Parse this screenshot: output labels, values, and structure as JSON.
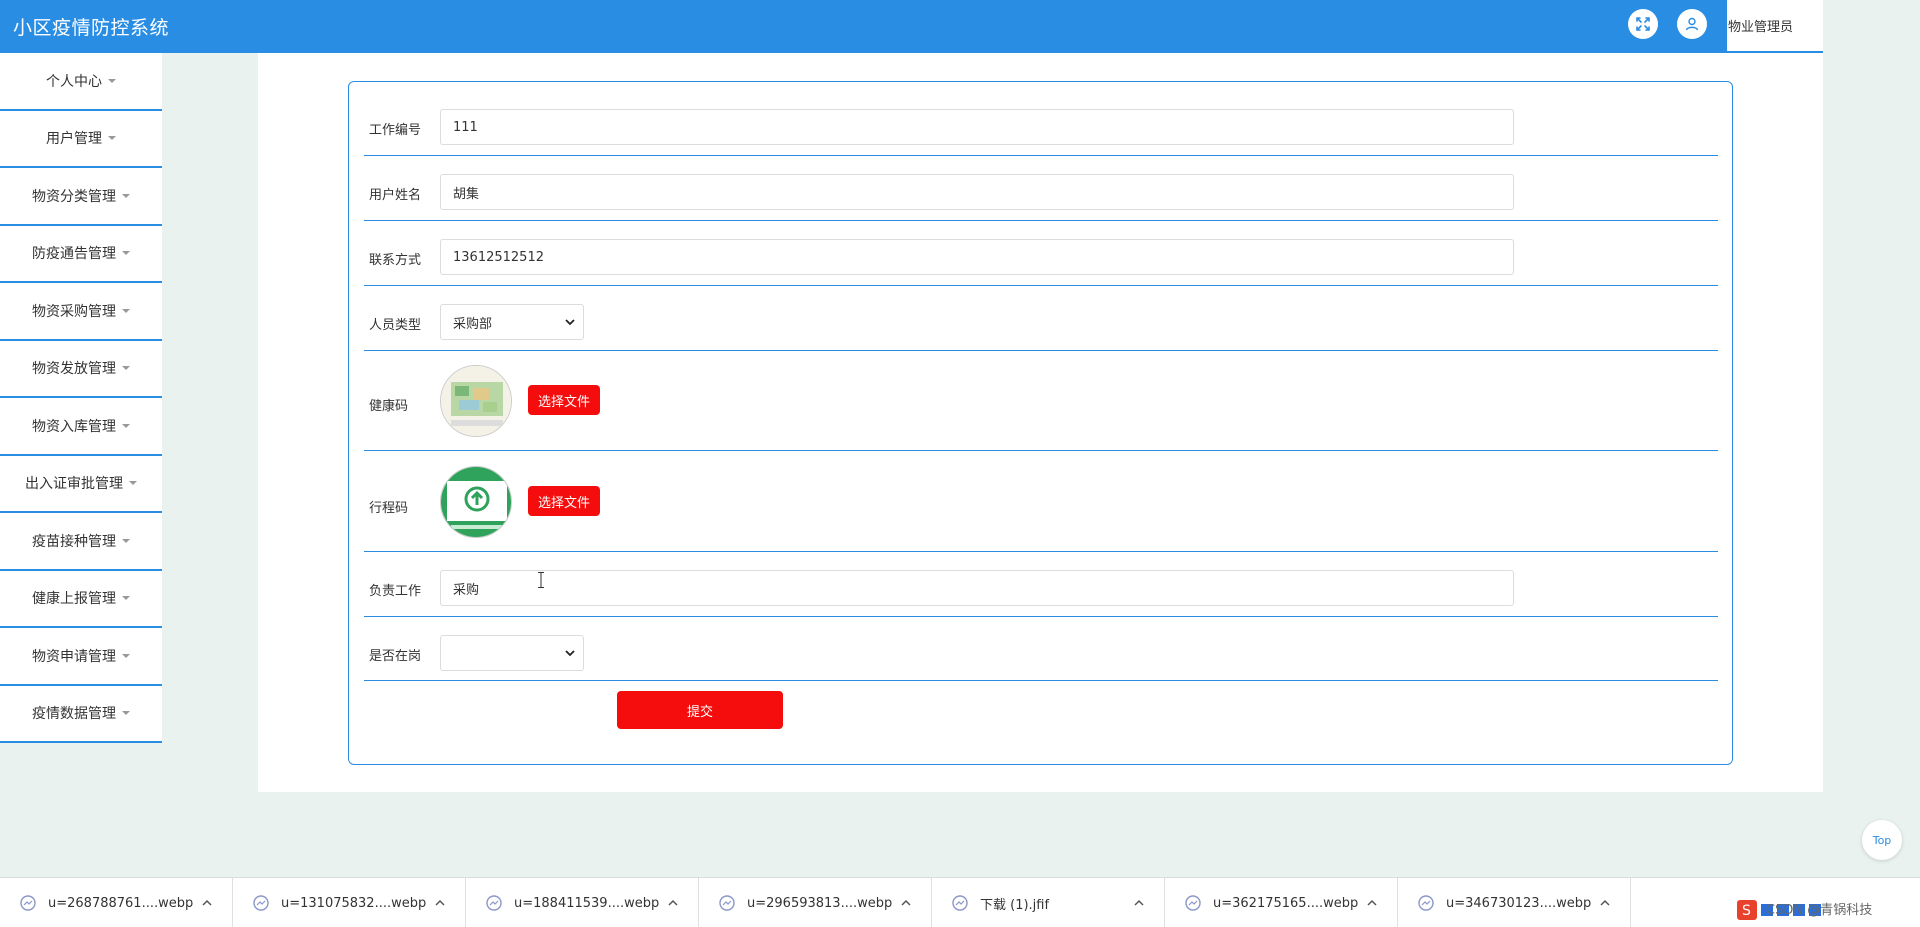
{
  "header": {
    "title": "小区疫情防控系统",
    "role": "物业管理员"
  },
  "sidebar": {
    "items": [
      {
        "label": "个人中心"
      },
      {
        "label": "用户管理"
      },
      {
        "label": "物资分类管理"
      },
      {
        "label": "防疫通告管理"
      },
      {
        "label": "物资采购管理"
      },
      {
        "label": "物资发放管理"
      },
      {
        "label": "物资入库管理"
      },
      {
        "label": "出入证审批管理"
      },
      {
        "label": "疫苗接种管理"
      },
      {
        "label": "健康上报管理"
      },
      {
        "label": "物资申请管理"
      },
      {
        "label": "疫情数据管理"
      }
    ]
  },
  "form": {
    "work_no": {
      "label": "工作编号",
      "value": "111"
    },
    "user_name": {
      "label": "用户姓名",
      "value": "胡集"
    },
    "contact": {
      "label": "联系方式",
      "value": "13612512512"
    },
    "person_type": {
      "label": "人员类型",
      "value": "采购部"
    },
    "health_code": {
      "label": "健康码",
      "button": "选择文件"
    },
    "trip_code": {
      "label": "行程码",
      "button": "选择文件"
    },
    "duty": {
      "label": "负责工作",
      "value": "采购"
    },
    "on_duty": {
      "label": "是否在岗",
      "value": ""
    },
    "submit": "提交"
  },
  "back_to_top": "Top",
  "downloads": [
    {
      "name": "u=268788761....webp"
    },
    {
      "name": "u=131075832....webp"
    },
    {
      "name": "u=188411539....webp"
    },
    {
      "name": "u=296593813....webp"
    },
    {
      "name": "下载 (1).jfif"
    },
    {
      "name": "u=362175165....webp"
    },
    {
      "name": "u=346730123....webp"
    }
  ],
  "watermark": "CSDN @青锅科技",
  "colors": {
    "primary": "#2a8de4",
    "danger": "#f50c0c",
    "bg": "#e9f2ee"
  }
}
